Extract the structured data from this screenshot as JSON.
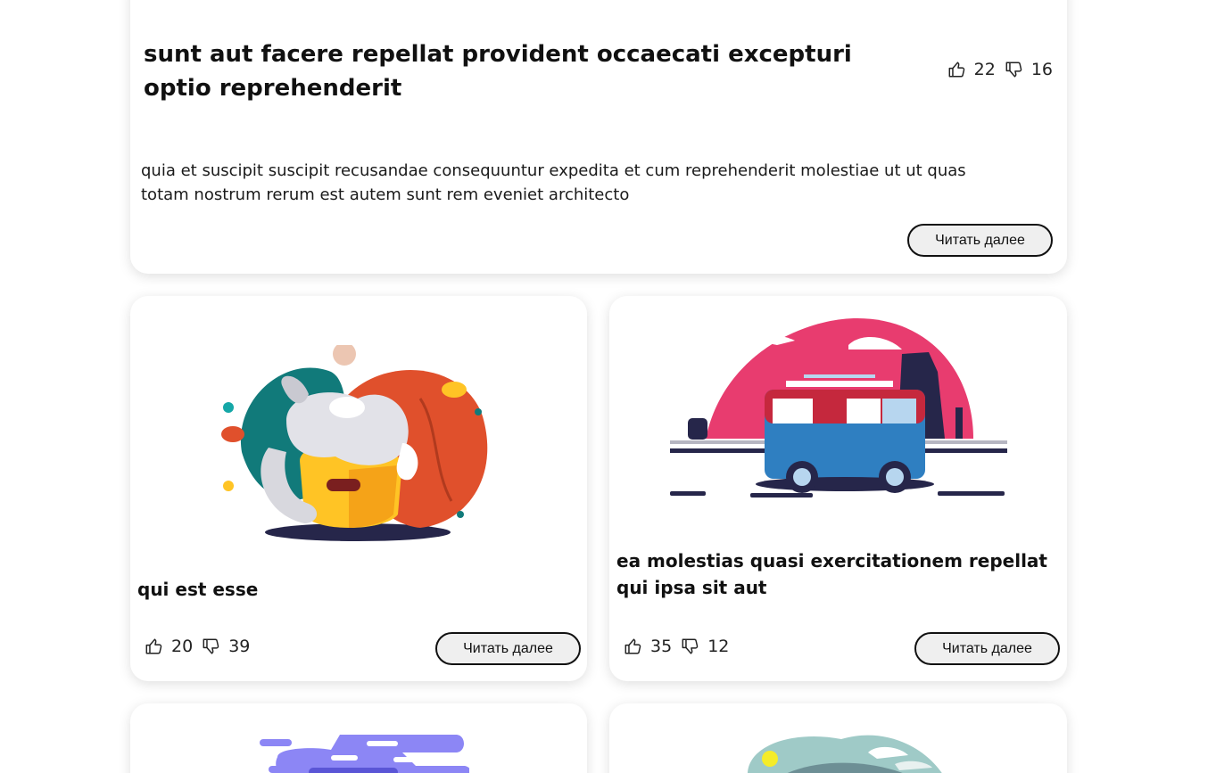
{
  "read_more_label": "Читать далее",
  "posts": {
    "featured": {
      "title": "sunt aut facere repellat provident occaecati excepturi optio reprehenderit",
      "body": "quia et suscipit suscipit recusandae consequuntur expedita et cum reprehenderit molestiae ut ut quas totam nostrum rerum est autem sunt rem eveniet architecto",
      "likes": "22",
      "dislikes": "16"
    },
    "a": {
      "title": "qui est esse",
      "likes": "20",
      "dislikes": "39",
      "image": "cat-sleeping-illustration"
    },
    "b": {
      "title": "ea molestias quasi exercitationem repellat qui ipsa sit aut",
      "likes": "35",
      "dislikes": "12",
      "image": "camper-van-illustration"
    },
    "c": {
      "image": "purple-clouds-illustration"
    },
    "d": {
      "image": "mountain-landscape-illustration"
    }
  },
  "icons": {
    "like": "thumbs-up-icon",
    "dislike": "thumbs-down-icon"
  },
  "colors": {
    "card_bg": "#ffffff",
    "button_bg": "#efefef",
    "button_border": "#111111",
    "text": "#111111",
    "shadow": "rgba(0,0,0,0.13)"
  }
}
